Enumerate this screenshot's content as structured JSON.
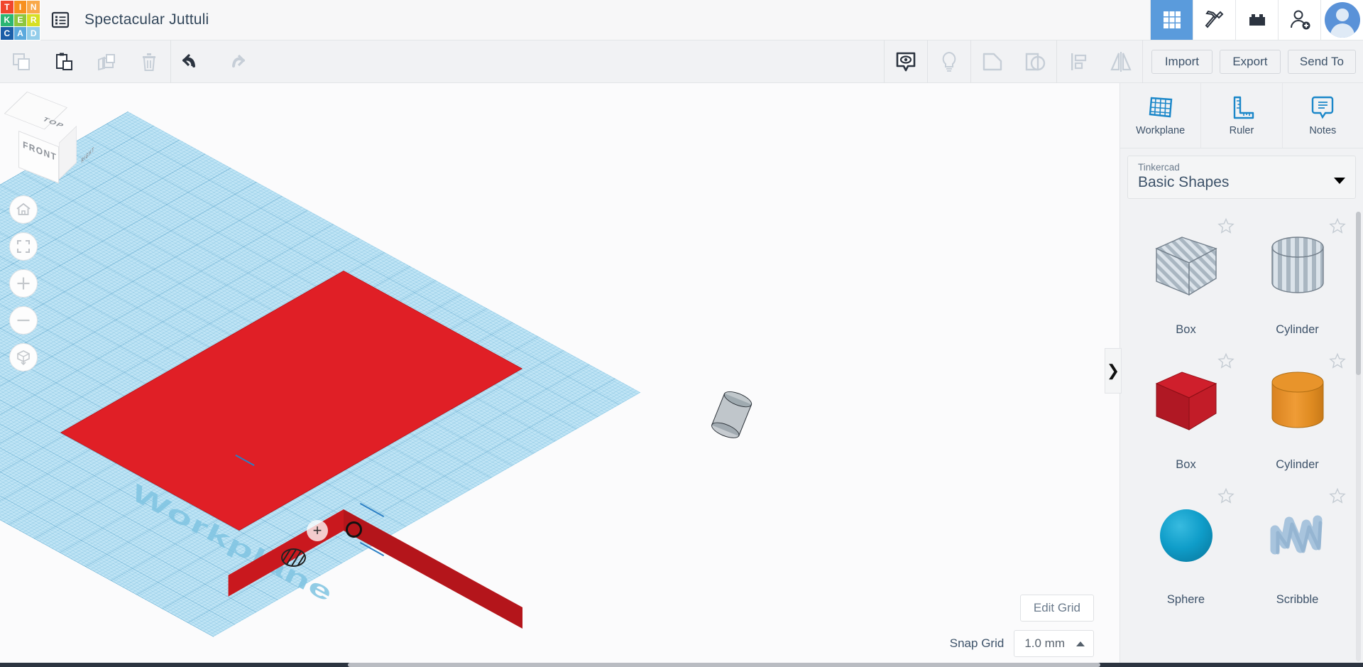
{
  "header": {
    "logo_letters": [
      {
        "ch": "T",
        "color": "#f0462d"
      },
      {
        "ch": "I",
        "color": "#f7901e"
      },
      {
        "ch": "N",
        "color": "#f9a94b"
      },
      {
        "ch": "K",
        "color": "#2bb673"
      },
      {
        "ch": "E",
        "color": "#8dc63f"
      },
      {
        "ch": "R",
        "color": "#d7df23"
      },
      {
        "ch": "C",
        "color": "#1b5ea8"
      },
      {
        "ch": "A",
        "color": "#5ba9dd"
      },
      {
        "ch": "D",
        "color": "#93cdea"
      }
    ],
    "project_list_icon": "list-icon",
    "title": "Spectacular Juttuli",
    "icons": [
      {
        "name": "gallery-grid-icon",
        "label": "Gallery",
        "active": true
      },
      {
        "name": "pickaxe-icon",
        "label": "Minecraft",
        "active": false
      },
      {
        "name": "lego-brick-icon",
        "label": "Blocks",
        "active": false
      },
      {
        "name": "add-person-icon",
        "label": "Invite",
        "active": false
      }
    ],
    "avatar_name": "user-avatar"
  },
  "toolbar": {
    "left_buttons": [
      {
        "name": "copy-button",
        "icon": "copy-icon",
        "enabled": false
      },
      {
        "name": "paste-button",
        "icon": "paste-icon",
        "enabled": true
      },
      {
        "name": "duplicate-button",
        "icon": "duplicate-icon",
        "enabled": false
      },
      {
        "name": "delete-button",
        "icon": "trash-icon",
        "enabled": false
      }
    ],
    "history_buttons": [
      {
        "name": "undo-button",
        "icon": "undo-arrow-icon",
        "enabled": true
      },
      {
        "name": "redo-button",
        "icon": "redo-arrow-icon",
        "enabled": false
      }
    ],
    "mid_buttons": [
      {
        "name": "show-hide-button",
        "icon": "eye-bubble-icon",
        "enabled": true
      },
      {
        "name": "light-button",
        "icon": "lightbulb-icon",
        "enabled": false
      },
      {
        "name": "group-button",
        "icon": "group-shapes-icon",
        "enabled": false
      },
      {
        "name": "ungroup-button",
        "icon": "ungroup-shapes-icon",
        "enabled": false
      },
      {
        "name": "align-button",
        "icon": "align-icon",
        "enabled": false
      },
      {
        "name": "mirror-button",
        "icon": "mirror-icon",
        "enabled": false
      }
    ],
    "text_buttons": [
      {
        "name": "import-button",
        "label": "Import"
      },
      {
        "name": "export-button",
        "label": "Export"
      },
      {
        "name": "send-to-button",
        "label": "Send To"
      }
    ]
  },
  "canvas": {
    "view_cube": {
      "top_label": "TOP",
      "front_label": "FRONT",
      "right_label": "RIGHT"
    },
    "view_controls": [
      {
        "name": "home-view-button",
        "icon": "home-icon"
      },
      {
        "name": "fit-view-button",
        "icon": "fit-frame-icon"
      },
      {
        "name": "zoom-in-button",
        "icon": "plus-icon"
      },
      {
        "name": "zoom-out-button",
        "icon": "minus-icon"
      },
      {
        "name": "perspective-toggle-button",
        "icon": "ortho-cube-icon"
      }
    ],
    "workplane_label": "Workplane",
    "objects": [
      {
        "name": "red-box-object",
        "shape": "box",
        "color": "#e01f26",
        "selected": true
      },
      {
        "name": "hole-cylinder-object",
        "shape": "cylinder",
        "color": "#6e7d87",
        "hole": true
      }
    ],
    "handles": [
      {
        "name": "move-handle",
        "icon": "plus-handle-icon"
      },
      {
        "name": "hole-toggle-handle",
        "icon": "striped-circle-icon"
      },
      {
        "name": "rotate-handle",
        "icon": "circle-outline-icon"
      }
    ],
    "edit_grid_label": "Edit Grid",
    "snap_grid_label": "Snap Grid",
    "snap_grid_value": "1.0 mm",
    "panel_toggle_icon": "chevron-right-icon",
    "grid_color": "#bfe4f5",
    "grid_line_color": "#2882b4"
  },
  "right_panel": {
    "tools": [
      {
        "name": "workplane-tool",
        "label": "Workplane",
        "icon": "workplane-grid-icon"
      },
      {
        "name": "ruler-tool",
        "label": "Ruler",
        "icon": "ruler-icon"
      },
      {
        "name": "notes-tool",
        "label": "Notes",
        "icon": "notes-bubble-icon"
      }
    ],
    "library_select": {
      "sub_label": "Tinkercad",
      "value": "Basic Shapes",
      "caret": "caret-down-icon"
    },
    "shapes": [
      {
        "name": "shape-box-hole",
        "label": "Box",
        "kind": "box-hole",
        "color": "#b8c4cd",
        "starred": false
      },
      {
        "name": "shape-cylinder-hole",
        "label": "Cylinder",
        "kind": "cylinder-hole",
        "color": "#b8c4cd",
        "starred": false
      },
      {
        "name": "shape-box-solid",
        "label": "Box",
        "kind": "box-solid",
        "color": "#c8202b",
        "starred": false
      },
      {
        "name": "shape-cylinder-solid",
        "label": "Cylinder",
        "kind": "cylinder-solid",
        "color": "#e3922a",
        "starred": false
      },
      {
        "name": "shape-sphere",
        "label": "Sphere",
        "kind": "sphere",
        "color": "#0f9dc9",
        "starred": false
      },
      {
        "name": "shape-scribble",
        "label": "Scribble",
        "kind": "scribble",
        "color": "#a8c4dd",
        "starred": false
      }
    ]
  }
}
